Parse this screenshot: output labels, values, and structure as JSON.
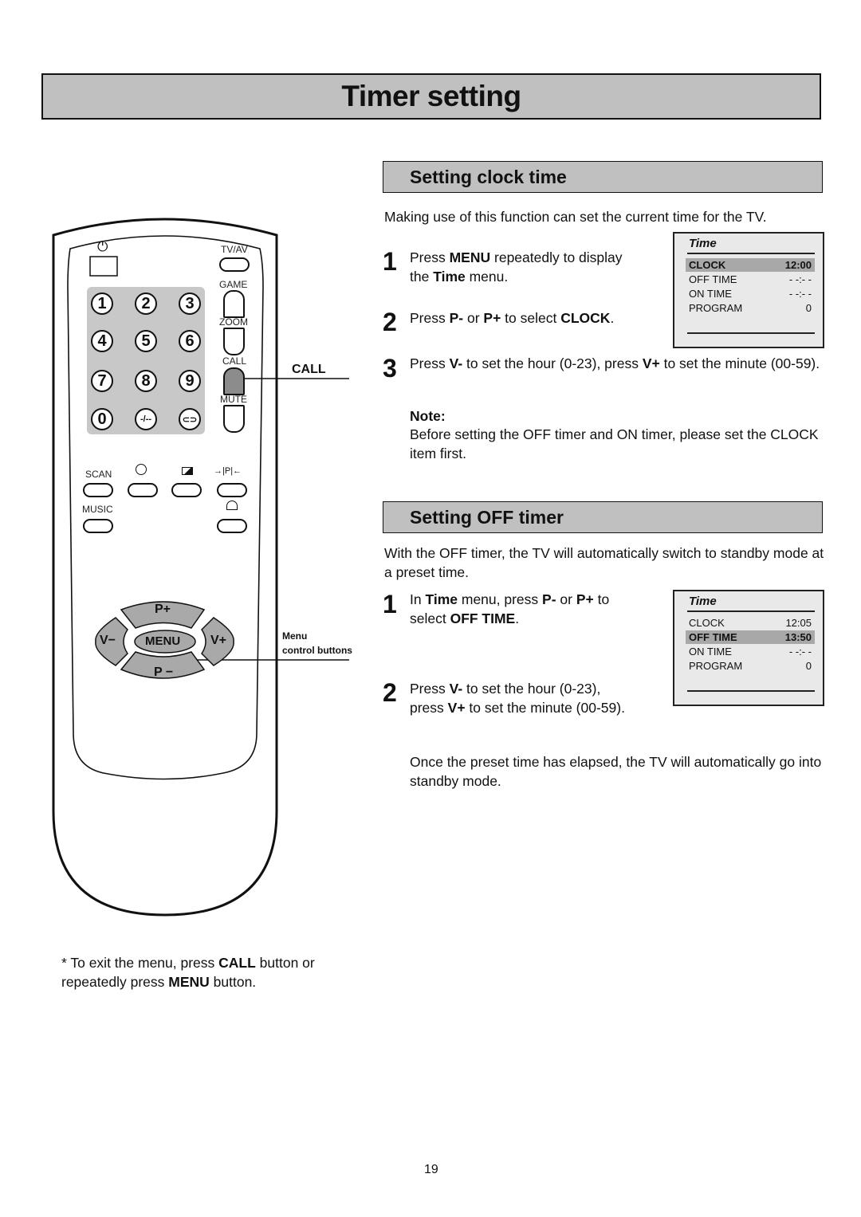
{
  "page": {
    "title": "Timer setting",
    "page_number": "19"
  },
  "remote": {
    "top_labels": {
      "tv_av": "TV/AV",
      "game": "GAME",
      "zoom": "ZOOM",
      "call": "CALL",
      "mute": "MUTE"
    },
    "number_keys": [
      "1",
      "2",
      "3",
      "4",
      "5",
      "6",
      "7",
      "8",
      "9",
      "0",
      "-/--",
      "⊂⊃"
    ],
    "function_labels": {
      "scan": "SCAN",
      "music": "MUSIC"
    },
    "menu_keys": {
      "p_plus": "P+",
      "p_minus": "P −",
      "v_minus": "V−",
      "v_plus": "V+",
      "menu": "MENU"
    },
    "callouts": {
      "call": "CALL",
      "menu_line1": "Menu",
      "menu_line2": "control buttons"
    },
    "colors": {
      "keypad_bg": "#c8c8c8",
      "call_button": "#8c8c8c",
      "menu_keys": "#a9a9a9"
    }
  },
  "footnote": {
    "prefix": "* To exit the menu, press ",
    "b1": "CALL",
    "mid": " button or repeatedly press ",
    "b2": "MENU",
    "suffix": " button."
  },
  "clock_section": {
    "heading": "Setting clock time",
    "intro": "Making use of this function can set the current time for the TV.",
    "steps": [
      {
        "num": "1",
        "parts": [
          "Press ",
          "MENU",
          " repeatedly to display the ",
          "Time",
          " menu."
        ]
      },
      {
        "num": "2",
        "parts": [
          "Press ",
          "P-",
          " or ",
          "P+",
          " to select ",
          "CLOCK",
          "."
        ]
      },
      {
        "num": "3",
        "parts": [
          "Press ",
          "V-",
          " to set the hour (0-23), press ",
          "V+",
          " to set the minute (00-59)."
        ]
      }
    ],
    "note_label": "Note:",
    "note_text": "Before setting the OFF timer and ON timer, please set the CLOCK item first.",
    "osd": {
      "title": "Time",
      "rows": [
        {
          "label": "CLOCK",
          "value": "12:00",
          "selected": true
        },
        {
          "label": "OFF TIME",
          "value": "- -:- -",
          "selected": false
        },
        {
          "label": "ON TIME",
          "value": "- -:- -",
          "selected": false
        },
        {
          "label": "PROGRAM",
          "value": "0",
          "selected": false
        }
      ]
    }
  },
  "off_section": {
    "heading": "Setting OFF timer",
    "intro": "With the OFF timer, the TV will automatically switch to standby mode at a preset time.",
    "steps": [
      {
        "num": "1",
        "parts": [
          "In ",
          "Time",
          " menu, press ",
          "P-",
          " or ",
          "P+",
          " to select ",
          "OFF TIME",
          "."
        ]
      },
      {
        "num": "2",
        "parts": [
          "Press ",
          "V-",
          " to set the hour (0-23), press ",
          "V+",
          " to set the minute (00-59)."
        ]
      }
    ],
    "closing": "Once the preset time has elapsed, the TV will automatically go into standby mode.",
    "osd": {
      "title": "Time",
      "rows": [
        {
          "label": "CLOCK",
          "value": "12:05",
          "selected": false
        },
        {
          "label": "OFF TIME",
          "value": "13:50",
          "selected": true
        },
        {
          "label": "ON TIME",
          "value": "- -:- -",
          "selected": false
        },
        {
          "label": "PROGRAM",
          "value": "0",
          "selected": false
        }
      ]
    }
  }
}
